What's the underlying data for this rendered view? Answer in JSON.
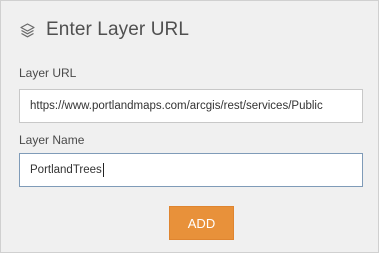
{
  "header": {
    "title": "Enter Layer URL",
    "icon": "layers-icon"
  },
  "form": {
    "url_label": "Layer URL",
    "url_value": "https://www.portlandmaps.com/arcgis/rest/services/Public",
    "name_label": "Layer Name",
    "name_value": "PortlandTrees"
  },
  "actions": {
    "add_label": "ADD"
  },
  "colors": {
    "accent": "#e8913a",
    "panel_bg": "#f0f0f0"
  }
}
